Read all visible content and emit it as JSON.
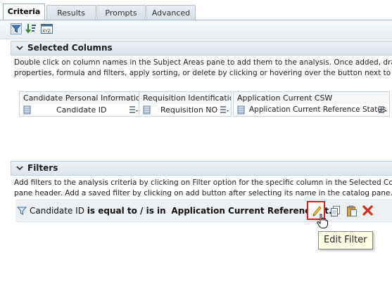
{
  "tabs": [
    {
      "label": "Criteria",
      "active": true
    },
    {
      "label": "Results",
      "active": false
    },
    {
      "label": "Prompts",
      "active": false
    },
    {
      "label": "Advanced",
      "active": false
    }
  ],
  "toolbar": {
    "icons": [
      "filter-icon",
      "sort-icon",
      "sql-icon"
    ]
  },
  "selected_columns": {
    "title": "Selected Columns",
    "description_line1": "Double click on column names in the Subject Areas pane to add them to the analysis. Once added, drag-and-d",
    "description_line2": "properties, formula and filters, apply sorting, or delete by clicking or hovering over the button next to its nam",
    "columns": [
      {
        "folder": "Candidate Personal Information",
        "name": "Candidate ID"
      },
      {
        "folder": "Requisition Identification",
        "name": "Requisition NO"
      },
      {
        "folder": "Application Current CSW",
        "name": "Application Current Reference Status"
      }
    ]
  },
  "filters": {
    "title": "Filters",
    "description_line1": "Add filters to the analysis criteria by clicking on Filter option for the specific column in the Selected Columns p",
    "description_line2": "pane header. Add a saved filter by clicking on add button after selecting its name in the catalog pane.",
    "filter_column": "Candidate ID",
    "filter_operator": "is equal to / is in",
    "filter_value": "Application Current Reference St..",
    "tooltip": "Edit Filter"
  },
  "colors": {
    "highlight": "#e01b1b",
    "delete": "#d42b1e",
    "tooltip_bg": "#ffffe6"
  }
}
